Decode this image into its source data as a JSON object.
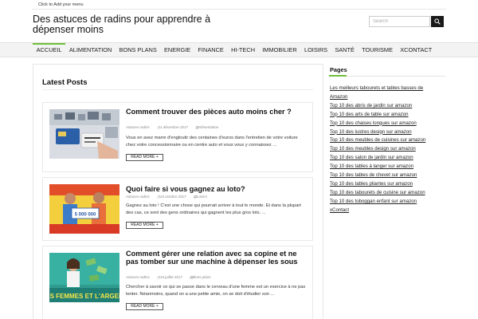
{
  "topbar": {
    "add_menu": "Click to Add your menu"
  },
  "site": {
    "title": "Des astuces de radins pour apprendre à dépenser moins"
  },
  "search": {
    "placeholder": "Search"
  },
  "nav": {
    "items": [
      "ACCUEIL",
      "ALIMENTATION",
      "BONS PLANS",
      "ENERGIE",
      "FINANCE",
      "HI-TECH",
      "IMMOBILIER",
      "LOISIRS",
      "SANTÉ",
      "TOURISME",
      "XCONTACT"
    ],
    "active": "ACCUEIL"
  },
  "main": {
    "heading": "Latest Posts",
    "read_more": "READ MORE",
    "posts": [
      {
        "title": "Comment trouver des pièces auto moins cher ?",
        "author": "Astuces-radins",
        "date": "1 décembre 2017",
        "category": "Alimentation",
        "excerpt": "Vous en avez marre d'engloutir des centaines d'euros dans l'entretien de votre voiture chez votre concessionnaire ou en centre auto et vous vous y connaissez ..."
      },
      {
        "title": "Quoi faire si vous gagnez au loto?",
        "author": "Astuces-radins",
        "date": "24 octobre 2017",
        "category": "Loisirs",
        "excerpt": "Gagnez au loto ! C'est une chose qui pourrait arriver à tout le monde. Et dans la plupart des cas, ce sont des gens ordinaires qui gagnent les plus gros lots. ..."
      },
      {
        "title": "Comment gérer une relation avec sa copine et ne pas tomber sur une machine à dépenser les sous",
        "author": "Astuces-radins",
        "date": "15 juillet 2017",
        "category": "Bons plans",
        "excerpt": "Chercher à savoir ce qui se passe dans le cerveau d'une femme est un exercice à ne pas tenter. Néanmoins, quand on a une petite amie, on se doit d'étudier son ..."
      }
    ]
  },
  "sidebar": {
    "title": "Pages",
    "links": [
      "Les meilleurs tabourets et tables basses de Amazon",
      "Top 10 des abris de jardin sur amazon",
      "Top 10 des arts de table sur amazon",
      "Top 10 des chaises longues sur amazon",
      "Top 10 des lustres design sur amazon",
      "Top 10 des meubles de cuisines sur amazon",
      "Top 10 des meubles design sur amazon",
      "Top 10 des salon de jardin sur amazon",
      "Top 10 des tables à langer sur amazon",
      "Top 10 des tables de chevet sur amazon",
      "Top 10 des tables pliantes sur amazon",
      "Top 10 des tabourets de cuisine sur amazon",
      "Top 10 des toboggan enfant sur amazon",
      "xContact"
    ]
  },
  "images": {
    "post3_banner": "ES FEMMES ET L'ARGEN",
    "post2_ticket": "5 000 000"
  }
}
